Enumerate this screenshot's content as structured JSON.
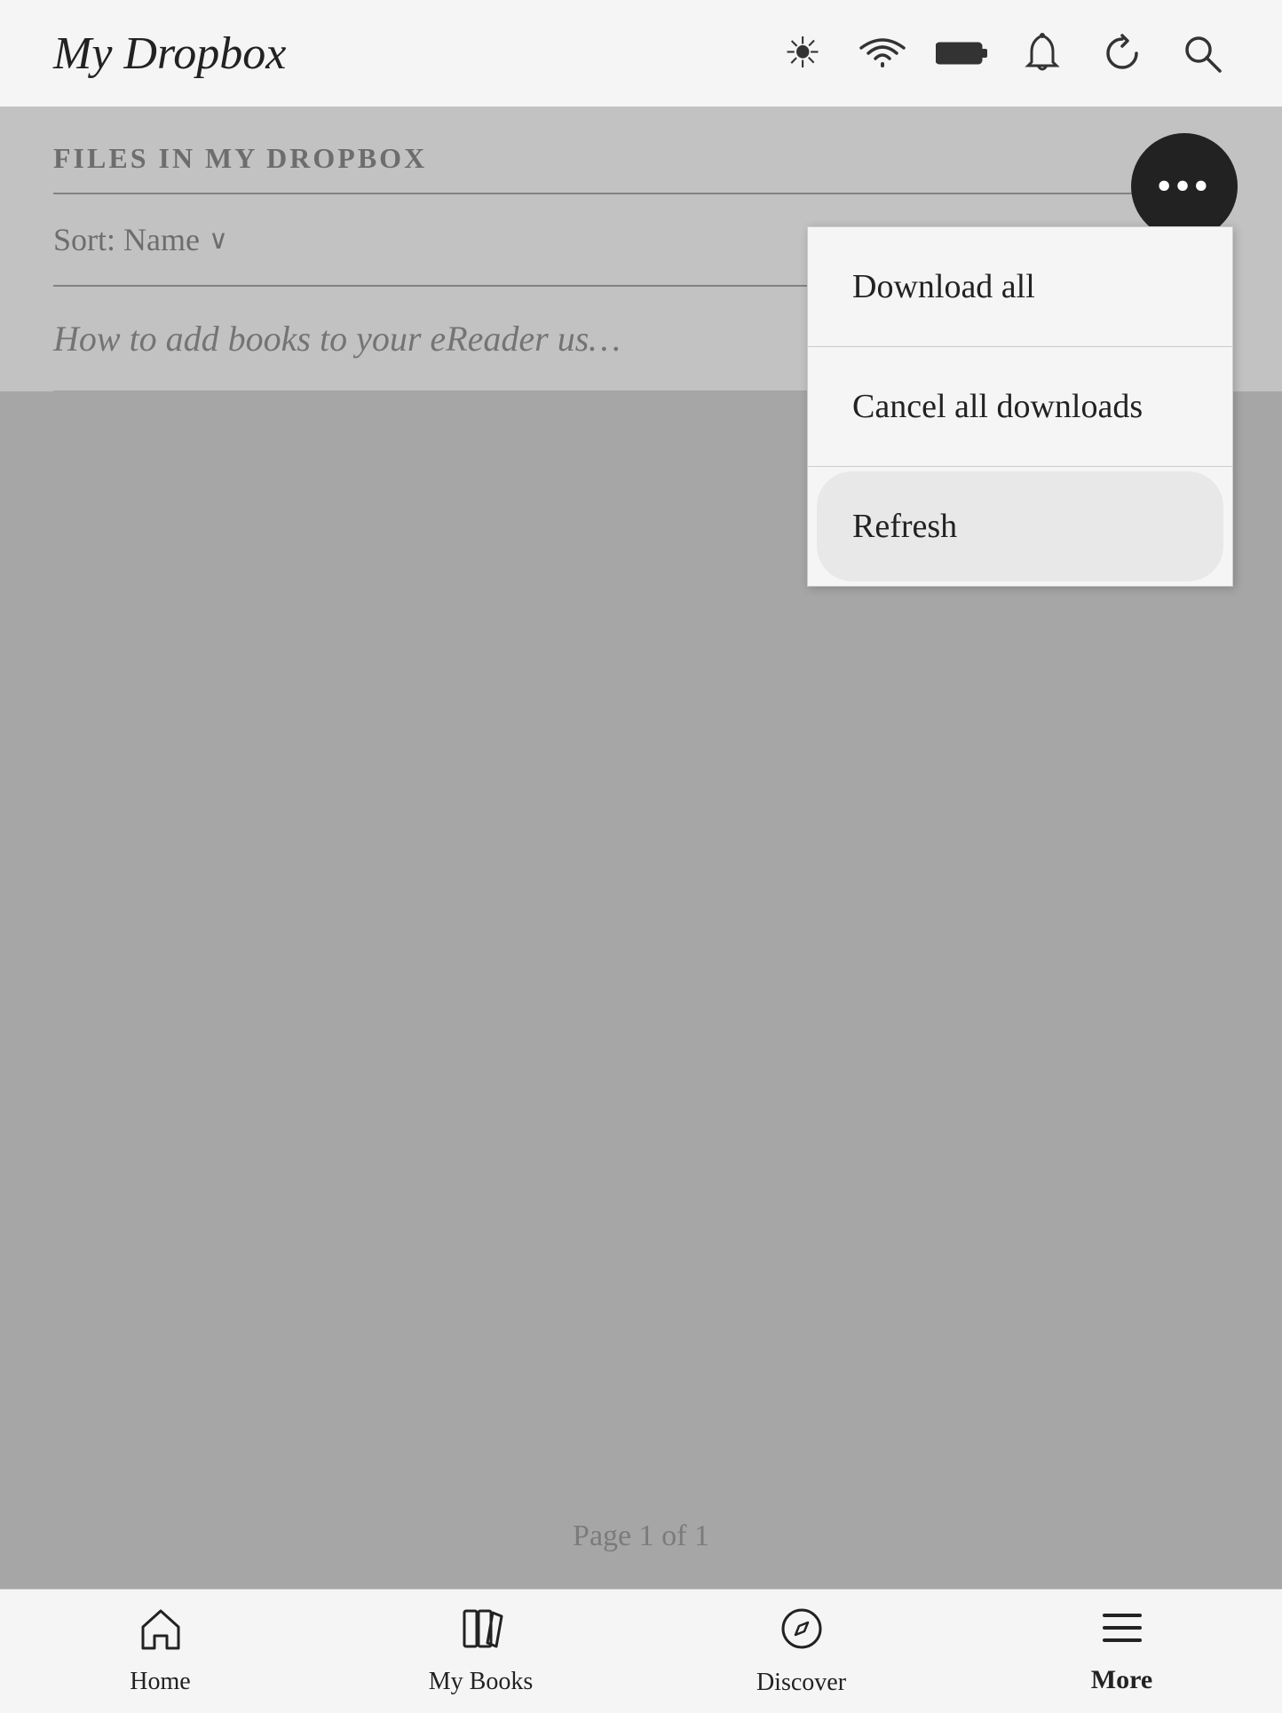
{
  "header": {
    "title": "My Dropbox",
    "icons": {
      "brightness": "☀",
      "wifi": "⊛",
      "battery": "battery",
      "notifications": "🔔",
      "sync": "↻",
      "search": "🔍"
    }
  },
  "section": {
    "title": "FILES IN MY DROPBOX"
  },
  "sort": {
    "label": "Sort: Name",
    "chevron": "∨"
  },
  "file": {
    "title": "How to add books to your eReader us…"
  },
  "dropdown": {
    "download_all": "Download all",
    "cancel_downloads": "Cancel all downloads",
    "refresh": "Refresh"
  },
  "pagination": {
    "text": "Page 1 of 1"
  },
  "bottom_nav": {
    "home": "Home",
    "my_books": "My Books",
    "discover": "Discover",
    "more": "More"
  }
}
